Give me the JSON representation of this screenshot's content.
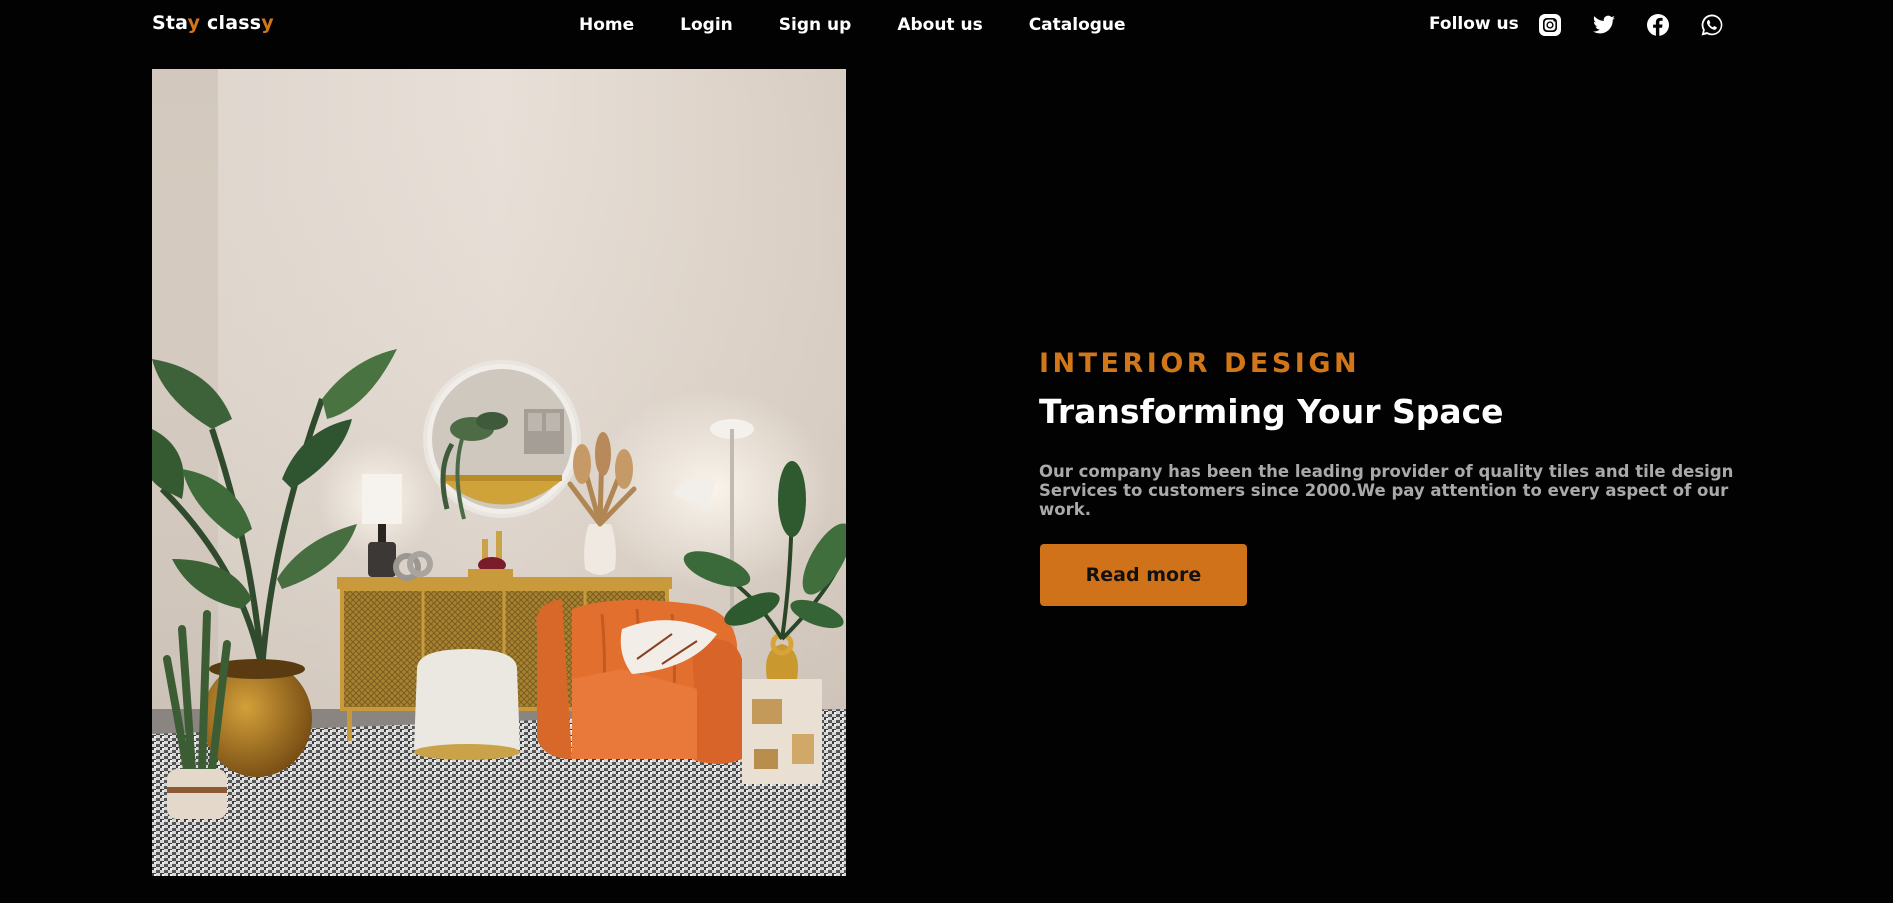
{
  "brand": {
    "logo_part1": "Sta",
    "logo_accent1": "y",
    "logo_part2": " class",
    "logo_accent2": "y",
    "accent_color": "#d2761a"
  },
  "nav": {
    "items": [
      {
        "label": "Home"
      },
      {
        "label": "Login"
      },
      {
        "label": "Sign up"
      },
      {
        "label": "About us"
      },
      {
        "label": "Catalogue"
      }
    ]
  },
  "social": {
    "label": "Follow us",
    "icons": [
      "instagram-icon",
      "twitter-icon",
      "facebook-icon",
      "whatsapp-icon"
    ]
  },
  "hero": {
    "eyebrow": "INTERIOR DESIGN",
    "title": "Transforming Your Space",
    "description": "Our company has been the leading provider of quality tiles and tile design Services to customers since 2000.We pay attention to every aspect of our work.",
    "button_label": "Read more",
    "button_color": "#cf7219"
  },
  "colors": {
    "background": "#020202",
    "text_primary": "#ffffff",
    "text_secondary": "#a9a9a9"
  }
}
